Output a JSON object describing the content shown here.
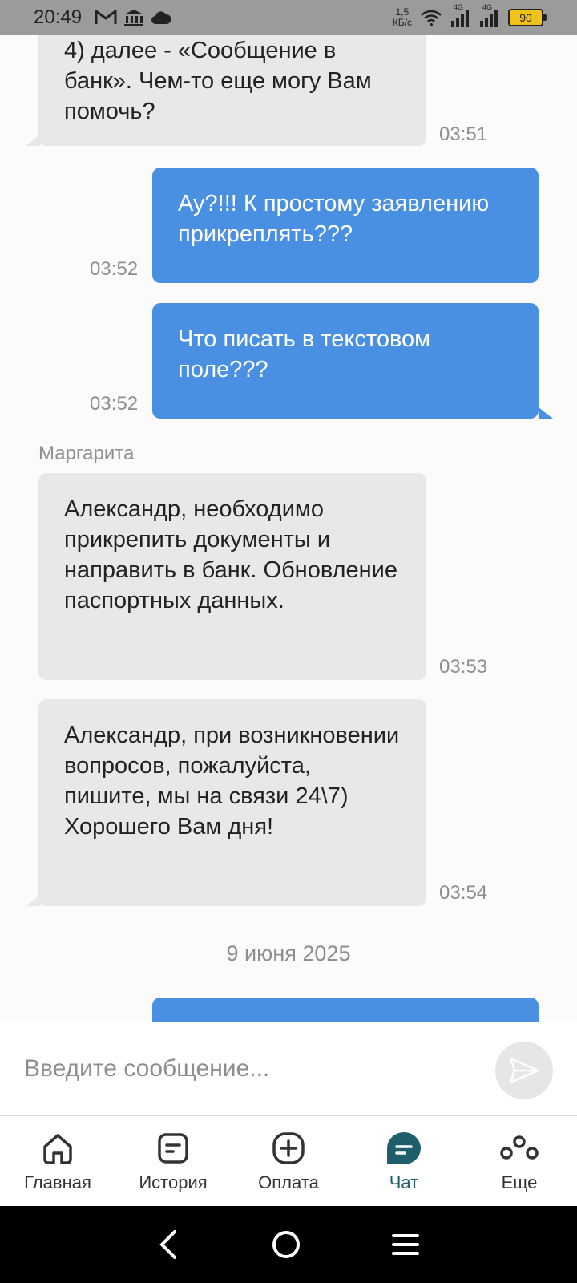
{
  "status_bar": {
    "time": "20:49",
    "speed_value": "1,5",
    "speed_unit": "КБ/с",
    "battery": "90",
    "network_1": "4G",
    "network_2": "4G"
  },
  "messages": [
    {
      "dir": "in",
      "text": "4) далее - «Сообщение в банк». Чем-то еще могу Вам помочь?",
      "time": "03:51"
    },
    {
      "dir": "out",
      "text": "Ау?!!! К простому заявлению прикреплять???",
      "time": "03:52"
    },
    {
      "dir": "out",
      "text": "Что писать в текстовом поле???",
      "time": "03:52"
    },
    {
      "dir": "in",
      "sender": "Маргарита",
      "text": "Александр, необходимо прикрепить документы и направить в банк. Обновление паспортных данных.",
      "time": "03:53"
    },
    {
      "dir": "in",
      "text": "Александр, при возникновении вопросов, пожалуйста, пишите, мы на связи 24\\7) Хорошего Вам дня!",
      "time": "03:54"
    }
  ],
  "date_separator": "9 июня 2025",
  "input": {
    "placeholder": "Введите сообщение..."
  },
  "nav": [
    {
      "label": "Главная",
      "icon": "home-icon"
    },
    {
      "label": "История",
      "icon": "history-icon"
    },
    {
      "label": "Оплата",
      "icon": "plus-circle-icon"
    },
    {
      "label": "Чат",
      "icon": "chat-icon",
      "active": true
    },
    {
      "label": "Еще",
      "icon": "more-icon"
    }
  ],
  "colors": {
    "accent": "#1f5f6b",
    "outgoing_bubble": "#4a90e2",
    "incoming_bubble": "#e8e8e8"
  }
}
